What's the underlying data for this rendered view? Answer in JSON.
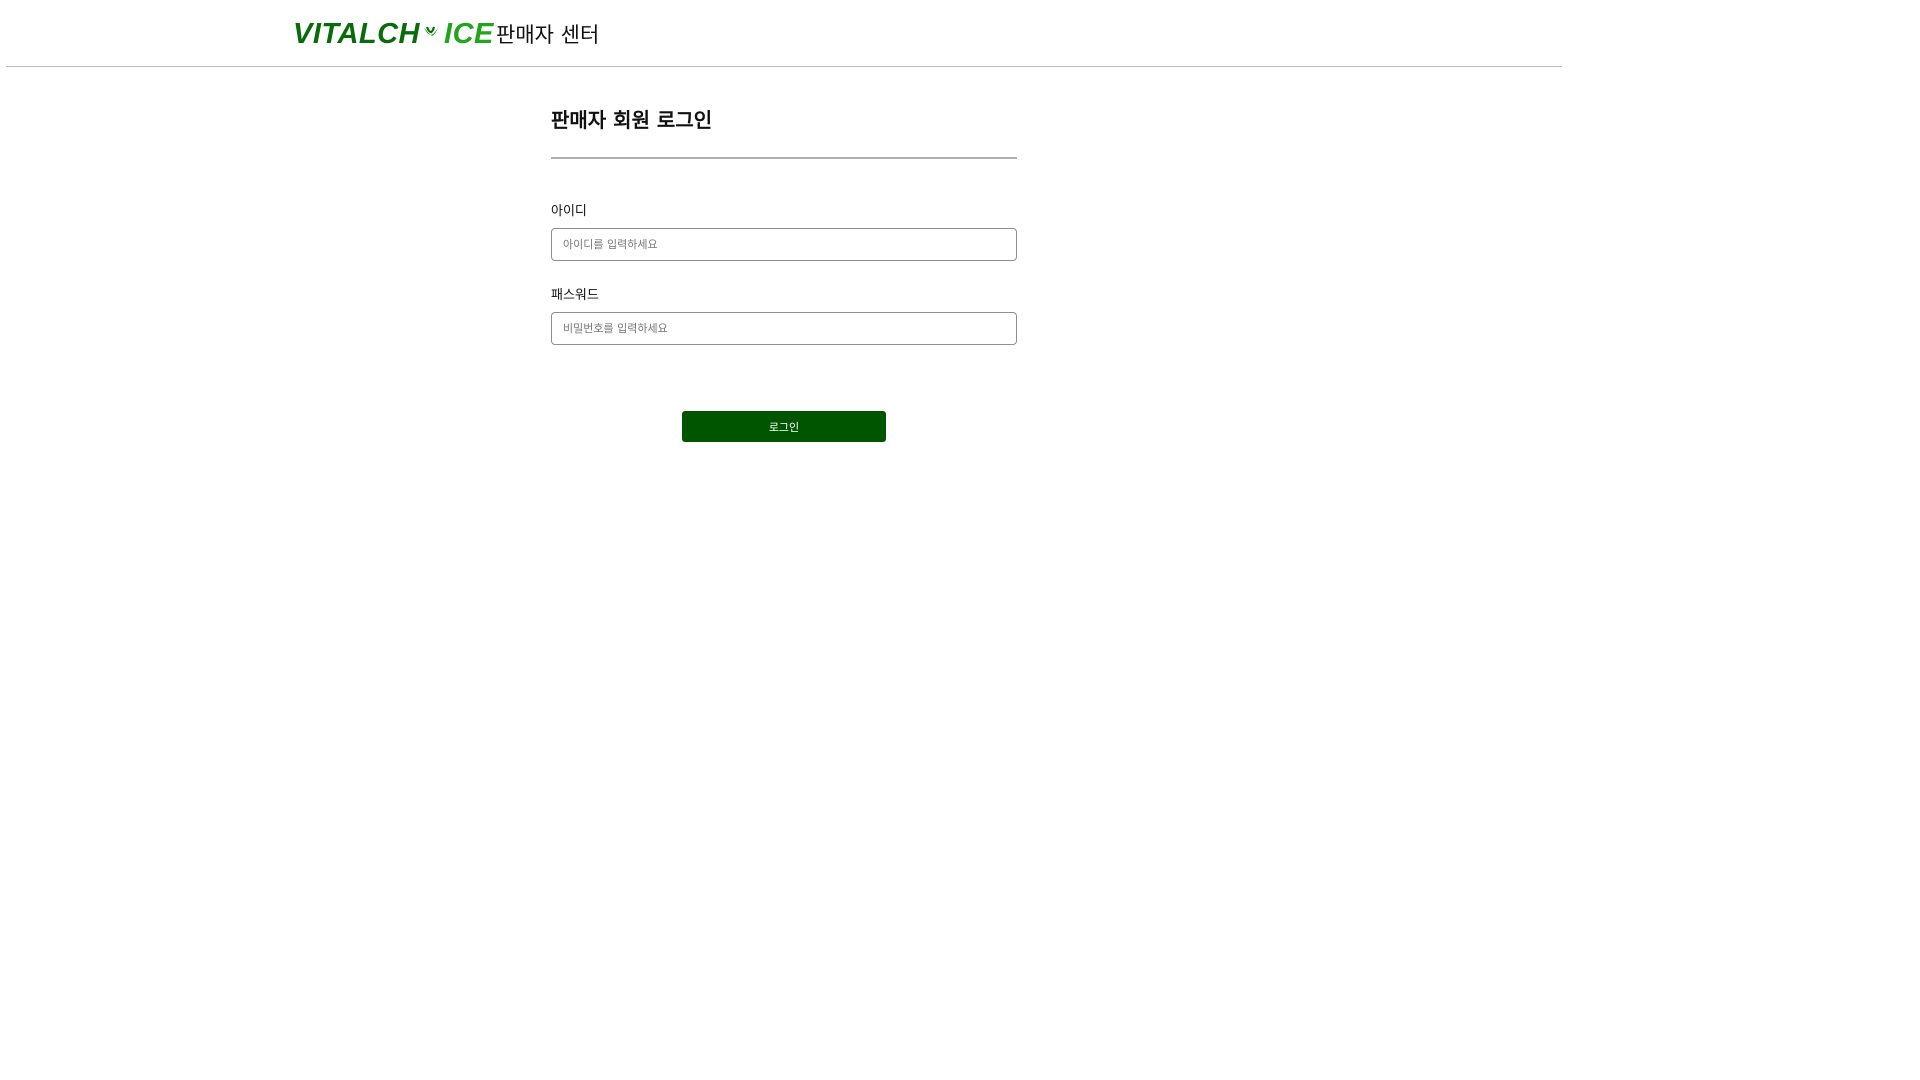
{
  "header": {
    "logo": {
      "part1": "VITALCH",
      "part2": "ICE"
    },
    "center_title": "판매자 센터"
  },
  "login": {
    "title": "판매자 회원 로그인",
    "id_label": "아이디",
    "id_placeholder": "아이디를 입력하세요",
    "id_value": "",
    "password_label": "패스워드",
    "password_placeholder": "비밀번호를 입력하세요",
    "password_value": "",
    "submit_label": "로그인"
  },
  "colors": {
    "brand_dark_green": "#0a6b0a",
    "brand_light_green": "#22a51d",
    "button_green": "#005500"
  }
}
